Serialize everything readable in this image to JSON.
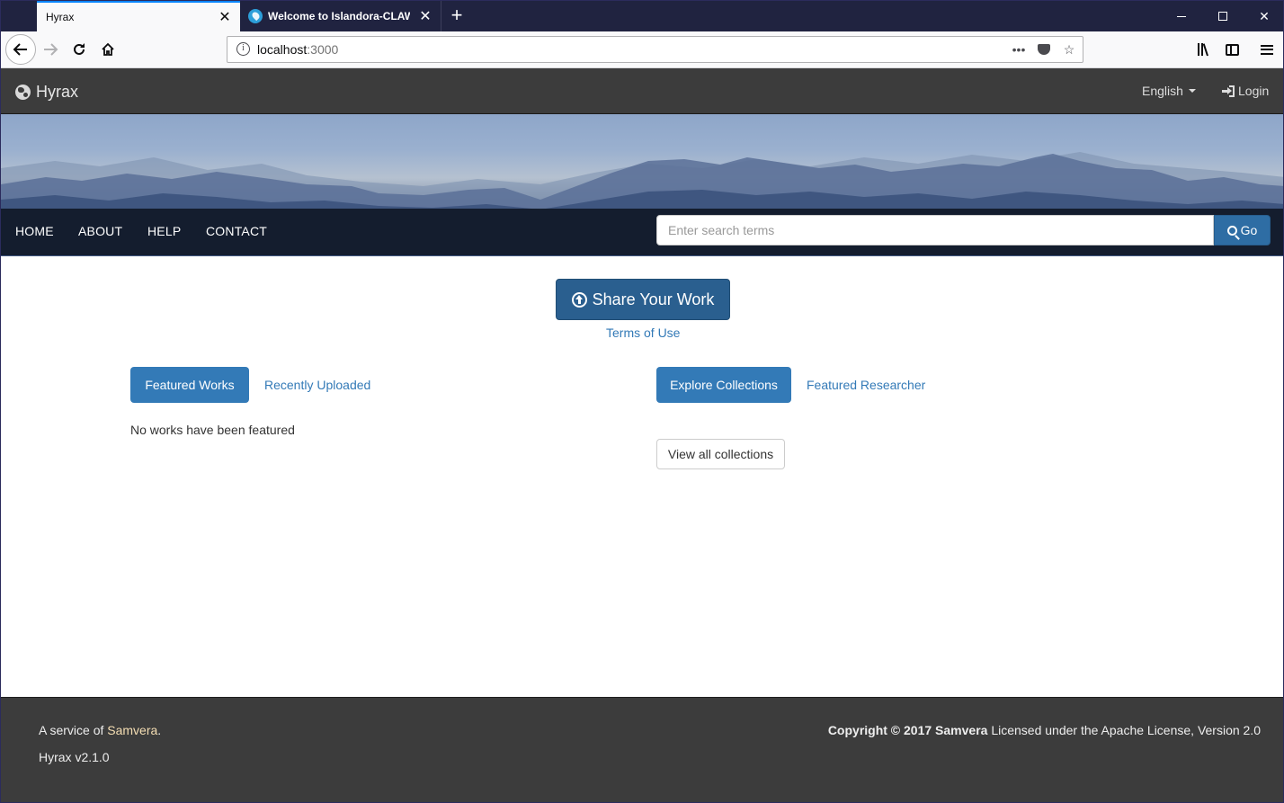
{
  "browser": {
    "tabs": [
      {
        "title": "Hyrax",
        "active": true
      },
      {
        "title": "Welcome to Islandora-CLAW | I",
        "active": false
      }
    ],
    "url": {
      "host": "localhost",
      "port": ":3000"
    },
    "new_tab": "+"
  },
  "header": {
    "brand": "Hyrax",
    "language": "English",
    "login": "Login"
  },
  "nav": {
    "items": [
      "HOME",
      "ABOUT",
      "HELP",
      "CONTACT"
    ],
    "search_placeholder": "Enter search terms",
    "go": "Go"
  },
  "main": {
    "share_button": "Share Your Work",
    "terms": "Terms of Use",
    "left_tabs": {
      "active": "Featured Works",
      "link": "Recently Uploaded"
    },
    "no_works": "No works have been featured",
    "right_tabs": {
      "active": "Explore Collections",
      "link": "Featured Researcher"
    },
    "view_all": "View all collections"
  },
  "footer": {
    "service_prefix": "A service of ",
    "service_link": "Samvera",
    "service_suffix": ".",
    "version": "Hyrax v2.1.0",
    "copyright_bold": "Copyright © 2017 Samvera",
    "copyright_rest": " Licensed under the Apache License, Version 2.0"
  },
  "colors": {
    "primary": "#337ab7",
    "header_bg": "#3c3c3c",
    "browser_chrome": "#202340"
  }
}
